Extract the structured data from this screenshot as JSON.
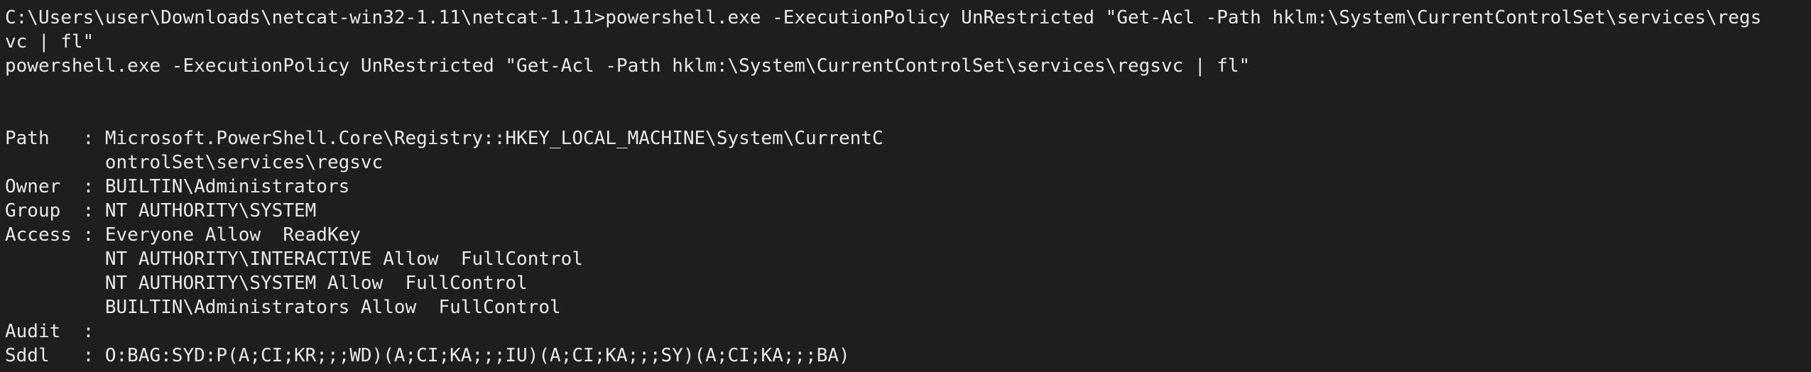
{
  "terminal": {
    "lines": [
      "C:\\Users\\user\\Downloads\\netcat-win32-1.11\\netcat-1.11>powershell.exe -ExecutionPolicy UnRestricted \"Get-Acl -Path hklm:\\System\\CurrentControlSet\\services\\regs",
      "vc | fl\"",
      "powershell.exe -ExecutionPolicy UnRestricted \"Get-Acl -Path hklm:\\System\\CurrentControlSet\\services\\regsvc | fl\"",
      "Path   : Microsoft.PowerShell.Core\\Registry::HKEY_LOCAL_MACHINE\\System\\CurrentC",
      "         ontrolSet\\services\\regsvc",
      "Owner  : BUILTIN\\Administrators",
      "Group  : NT AUTHORITY\\SYSTEM",
      "Access : Everyone Allow  ReadKey",
      "         NT AUTHORITY\\INTERACTIVE Allow  FullControl",
      "         NT AUTHORITY\\SYSTEM Allow  FullControl",
      "         BUILTIN\\Administrators Allow  FullControl",
      "Audit  :",
      "Sddl   : O:BAG:SYD:P(A;CI;KR;;;WD)(A;CI;KA;;;IU)(A;CI;KA;;;SY)(A;CI;KA;;;BA)"
    ]
  }
}
